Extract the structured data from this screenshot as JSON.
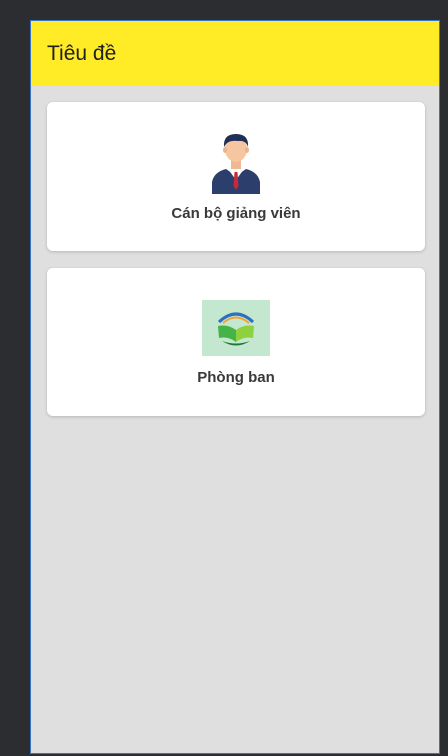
{
  "app": {
    "title": "Tiêu đề"
  },
  "cards": [
    {
      "label": "Cán bộ giảng viên",
      "icon": "teacher-avatar-icon"
    },
    {
      "label": "Phòng ban",
      "icon": "book-logo-icon"
    }
  ],
  "colors": {
    "toolbar": "#ffeb26",
    "background": "#dfdfdf",
    "card": "#ffffff",
    "frame": "#2b2d31"
  }
}
